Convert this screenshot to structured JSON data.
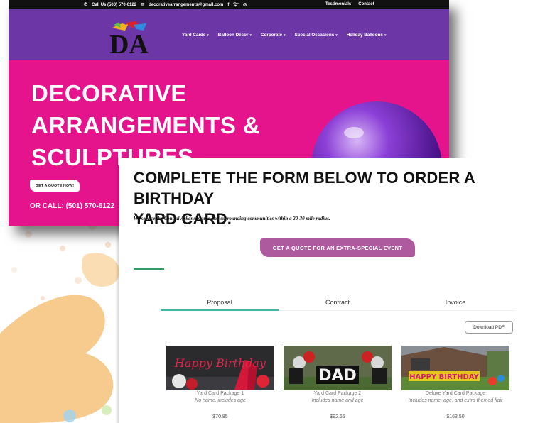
{
  "topbar": {
    "phone": "Call Us (500) 570-6122",
    "email": "decorativearrangements@gmail.com",
    "social": [
      "f",
      "t",
      "ig"
    ],
    "links": [
      "Testimonials",
      "Contact"
    ]
  },
  "nav": {
    "logo_text": "DA",
    "items": [
      {
        "label": "Yard Cards"
      },
      {
        "label": "Balloon Décor"
      },
      {
        "label": "Corporate"
      },
      {
        "label": "Special Occasions"
      },
      {
        "label": "Holiday Balloons"
      }
    ]
  },
  "hero": {
    "title_lines": [
      "DECORATIVE",
      "ARRANGEMENTS &",
      "SCULPTURES"
    ],
    "quote_button": "GET A QUOTE NOW!",
    "call_label": "OR CALL:",
    "call_number": "(501) 570-6122"
  },
  "form": {
    "title_line1": "COMPLETE THE FORM BELOW TO ORDER A BIRTHDAY",
    "title_line2": "YARD CARD.",
    "service_text": "We service the Central Arkansas area and surrounding communities within a 20-30 mile radius.",
    "special_button": "GET A QUOTE FOR AN EXTRA-SPECIAL EVENT",
    "tabs": [
      {
        "label": "Proposal",
        "active": true
      },
      {
        "label": "Contract",
        "active": false
      },
      {
        "label": "Invoice",
        "active": false
      }
    ],
    "download_pdf": "Download PDF",
    "packages": [
      {
        "name": "Yard Card Package 1",
        "desc": "No name, includes age",
        "price": "$70.85",
        "sign_text": "Happy Birthday"
      },
      {
        "name": "Yard Card Package 2",
        "desc": "Includes name and age",
        "price": "$92.65",
        "sign_text": "DAD"
      },
      {
        "name": "Deluxe Yard Card Package",
        "desc": "Includes name, age, and extra themed flair",
        "price": "$163.50",
        "sign_text": "HAPPY BIRTHDAY"
      }
    ]
  },
  "colors": {
    "hero_pink": "#e6148c",
    "nav_purple": "#6c36a6",
    "special_button": "#ad5a9e",
    "tab_underline": "#3fb6a8",
    "accent_green": "#2f9d5f"
  }
}
